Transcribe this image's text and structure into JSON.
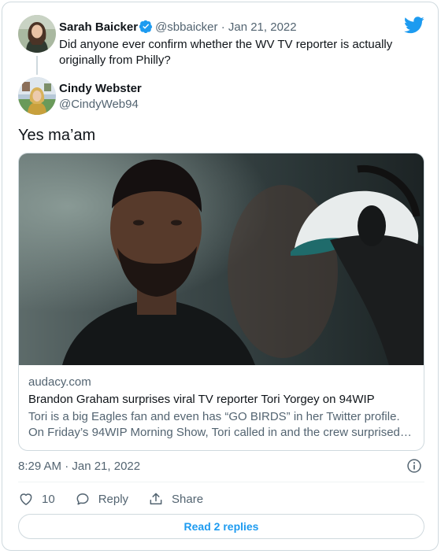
{
  "quoted_tweet": {
    "author_name": "Sarah Baicker",
    "author_handle": "@sbbaicker",
    "separator": "·",
    "date": "Jan 21, 2022",
    "text": "Did anyone ever confirm whether the WV TV reporter is actually originally from Philly?",
    "verified": true
  },
  "tweet": {
    "author_name": "Cindy Webster",
    "author_handle": "@CindyWeb94",
    "text": "Yes ma’am",
    "timestamp": "8:29 AM · Jan 21, 2022"
  },
  "link_card": {
    "domain": "audacy.com",
    "title": "Brandon Graham surprises viral TV reporter Tori Yorgey on 94WIP",
    "description": "Tori is a big Eagles fan and even has “GO BIRDS” in her Twitter profile. On Friday’s 94WIP Morning Show, Tori called in and the crew surprised her ..."
  },
  "actions": {
    "like_count": "10",
    "reply_label": "Reply",
    "share_label": "Share"
  },
  "read_replies_label": "Read 2 replies",
  "icons": {
    "brand": "twitter-bird-icon",
    "verified": "verified-badge-icon",
    "info": "info-icon",
    "like": "heart-icon",
    "reply": "speech-bubble-icon",
    "share": "share-upload-icon"
  },
  "colors": {
    "accent": "#1d9bf0",
    "text": "#0f1419",
    "muted": "#536471",
    "border": "#cfd9de"
  }
}
